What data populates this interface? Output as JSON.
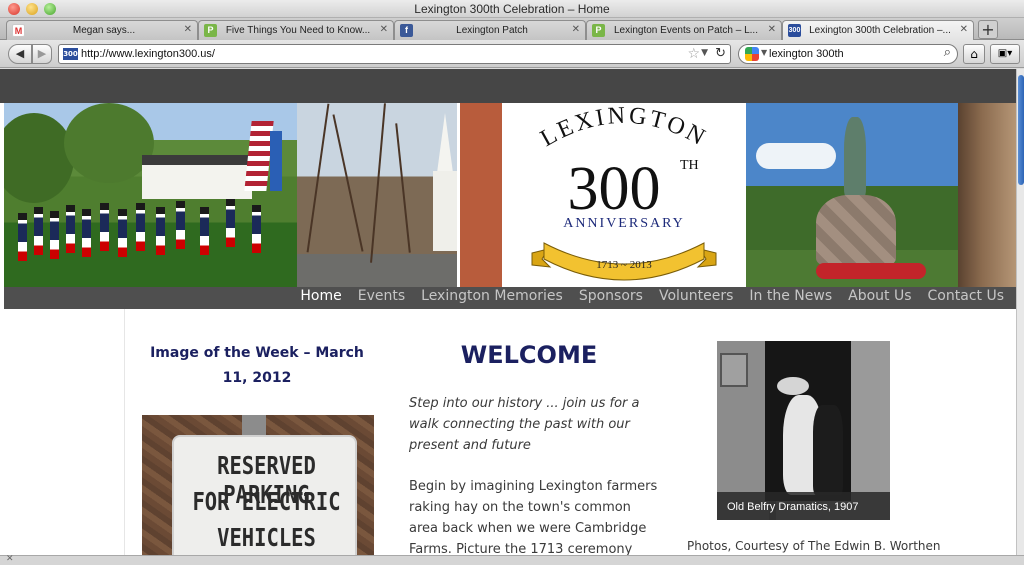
{
  "window": {
    "title": "Lexington 300th Celebration – Home"
  },
  "tabs": [
    {
      "label": "Megan says...",
      "favicon": "gmail-icon"
    },
    {
      "label": "Five Things You Need to Know...",
      "favicon": "patch-icon"
    },
    {
      "label": "Lexington Patch",
      "favicon": "facebook-icon"
    },
    {
      "label": "Lexington Events on Patch – L...",
      "favicon": "patch-icon"
    },
    {
      "label": "Lexington 300th Celebration –...",
      "favicon": "lex300-icon"
    }
  ],
  "newtab_label": "+",
  "toolbar": {
    "url": "http://www.lexington300.us/",
    "search_query": "lexington 300th",
    "url_favicon_text": "300"
  },
  "logo": {
    "top": "LEXINGTON",
    "number": "300",
    "sup": "TH",
    "anniversary": "ANNIVERSARY",
    "years": "1713 ~ 2013"
  },
  "nav": {
    "items": [
      "Home",
      "Events",
      "Lexington Memories",
      "Sponsors",
      "Volunteers",
      "In the News",
      "About Us",
      "Contact Us"
    ]
  },
  "image_of_week": {
    "title_line1": "Image of the Week – March",
    "title_line2": "11, 2012",
    "sign_lines": [
      "RESERVED PARKING",
      "FOR ELECTRIC",
      "VEHICLES ONLY"
    ]
  },
  "main": {
    "heading": "WELCOME",
    "intro_lines": [
      "Step into our history ... join us for a",
      "walk connecting the past with our",
      "present and future"
    ],
    "body_lines": [
      "Begin by imagining Lexington farmers",
      "raking hay on the town's common",
      "area back when we were Cambridge",
      "Farms. Picture the 1713 ceremony"
    ]
  },
  "side_photo": {
    "caption": "Old Belfry Dramatics, 1907",
    "credit": "Photos, Courtesy of The Edwin B. Worthen"
  },
  "colors": {
    "heading_navy": "#1b2060",
    "nav_bg": "#4f4f4f",
    "banner_gold": "#f2c230"
  }
}
